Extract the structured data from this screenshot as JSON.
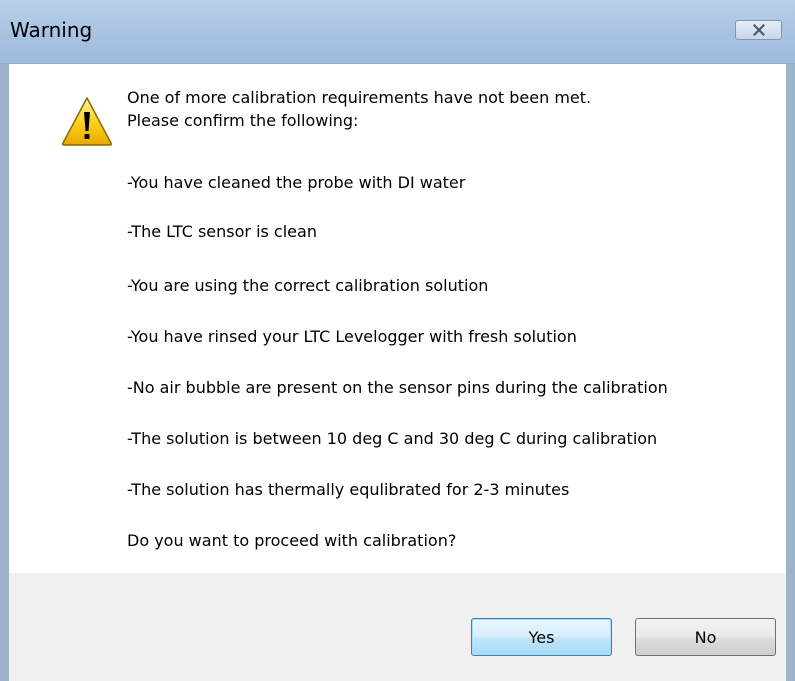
{
  "window": {
    "title": "Warning"
  },
  "icons": {
    "close": "close-icon",
    "warning": "warning-triangle-icon"
  },
  "message": {
    "intro_line1": "One of more calibration requirements have not been met.",
    "intro_line2": "Please confirm the following:",
    "items": [
      "-You have cleaned the probe with DI water",
      "-The LTC sensor is clean",
      "-You are using the correct calibration solution",
      "-You have rinsed your LTC Levelogger with fresh solution",
      "-No air bubble are present on the sensor pins during the calibration",
      "-The solution is between 10 deg C and 30 deg C during calibration",
      "-The solution has thermally equlibrated for 2-3 minutes"
    ],
    "question": "Do you want to proceed with calibration?"
  },
  "buttons": {
    "yes": "Yes",
    "no": "No"
  },
  "colors": {
    "titlebar": "#a9c4e2",
    "footer": "#f0f0f0",
    "default_button_border": "#3c7fb1",
    "warning_yellow": "#f5c400"
  }
}
